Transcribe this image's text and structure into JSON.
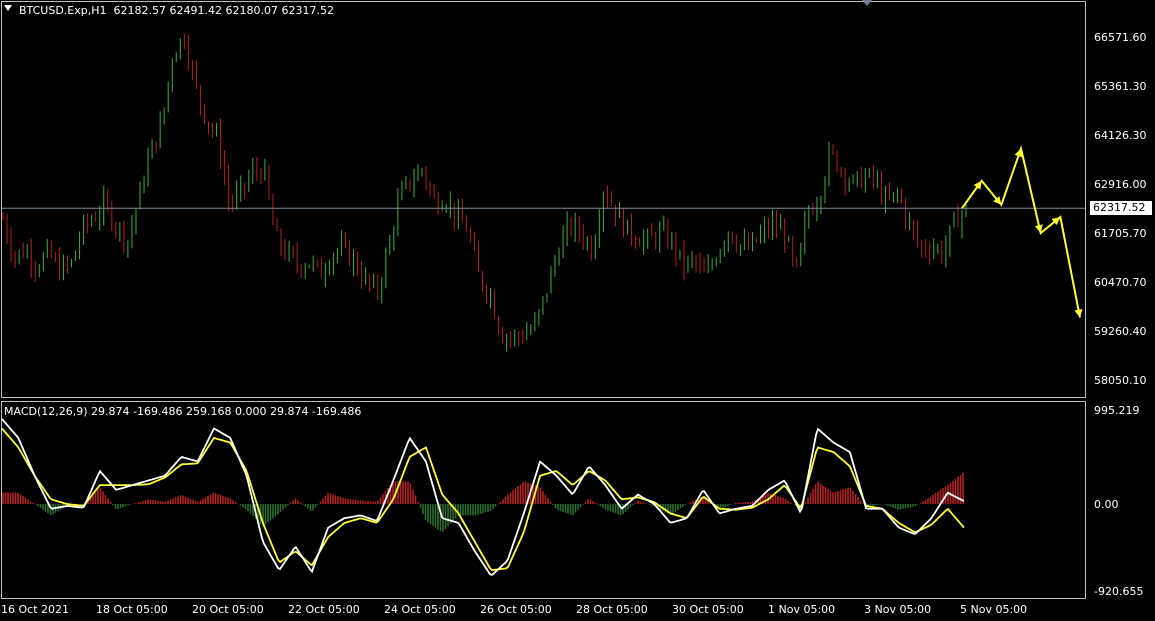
{
  "main_panel": {
    "symbol": "BTCUSD.Exp,H1",
    "ohlc": "62182.57 62491.42 62180.07 62317.52",
    "price_labels": [
      "66571.60",
      "65361.30",
      "64126.30",
      "62916.00",
      "61705.70",
      "60470.70",
      "59260.40",
      "58050.10"
    ],
    "current_price": "62317.52"
  },
  "macd_panel": {
    "indicator_label": "MACD(12,26,9) 29.874 -169.486 259.168 0.000 29.874 -169.486",
    "scale_labels": [
      "995.219",
      "0.00",
      "-920.655"
    ]
  },
  "time_axis": {
    "labels": [
      "16 Oct 2021",
      "18 Oct 05:00",
      "20 Oct 05:00",
      "22 Oct 05:00",
      "24 Oct 05:00",
      "26 Oct 05:00",
      "28 Oct 05:00",
      "30 Oct 05:00",
      "1 Nov 05:00",
      "3 Nov 05:00",
      "5 Nov 05:00"
    ]
  },
  "colors": {
    "bull": "#3cb043",
    "bear": "#b22222",
    "signal": "#ffff33",
    "macd": "#ffffff",
    "hist_pos": "#b22222",
    "hist_neg": "#2e6b2e"
  },
  "chart_data": {
    "type": "candlestick",
    "price_path": [
      62050,
      61100,
      61300,
      60900,
      61200,
      60800,
      60900,
      61800,
      62100,
      62400,
      61900,
      61500,
      62600,
      63700,
      64400,
      66200,
      66600,
      65300,
      64500,
      64000,
      62400,
      62700,
      63200,
      63300,
      61600,
      61200,
      60900,
      61000,
      60700,
      61200,
      61300,
      61000,
      60500,
      60200,
      61300,
      62600,
      63000,
      63300,
      62500,
      62600,
      62100,
      61800,
      60600,
      60200,
      59200,
      59100,
      59200,
      59400,
      60300,
      61300,
      61900,
      61700,
      61300,
      62800,
      62300,
      61800,
      61600,
      61500,
      61700,
      61500,
      60900,
      61000,
      60600,
      61200,
      61800,
      61400,
      61300,
      61700,
      61900,
      61700,
      60600,
      62200,
      62600,
      63700,
      63300,
      62900,
      63100,
      63000,
      62400,
      62700,
      61900,
      61300,
      61400,
      61200,
      62000,
      62317.52
    ],
    "forecast_path": [
      62317.52,
      63000,
      62400,
      63800,
      61700,
      62100,
      59600
    ],
    "macd_line": [
      900,
      700,
      300,
      -50,
      -20,
      -40,
      350,
      150,
      200,
      250,
      300,
      500,
      450,
      800,
      700,
      300,
      -400,
      -700,
      -450,
      -720,
      -250,
      -150,
      -120,
      -180,
      250,
      700,
      450,
      -150,
      -200,
      -500,
      -760,
      -600,
      -100,
      450,
      300,
      100,
      400,
      200,
      -50,
      100,
      0,
      -200,
      -150,
      150,
      -100,
      -50,
      -20,
      150,
      250,
      -100,
      800,
      650,
      550,
      -50,
      -50,
      -250,
      -320,
      -150,
      120,
      30
    ],
    "signal_line": [
      800,
      600,
      300,
      50,
      0,
      -20,
      200,
      200,
      200,
      210,
      280,
      420,
      430,
      700,
      650,
      350,
      -200,
      -620,
      -500,
      -650,
      -350,
      -200,
      -150,
      -200,
      50,
      500,
      600,
      100,
      -100,
      -400,
      -700,
      -680,
      -300,
      300,
      350,
      200,
      350,
      250,
      50,
      70,
      20,
      -100,
      -150,
      80,
      -50,
      -60,
      -40,
      50,
      200,
      -50,
      600,
      550,
      400,
      -20,
      -50,
      -200,
      -300,
      -220,
      -50,
      -250
    ]
  }
}
